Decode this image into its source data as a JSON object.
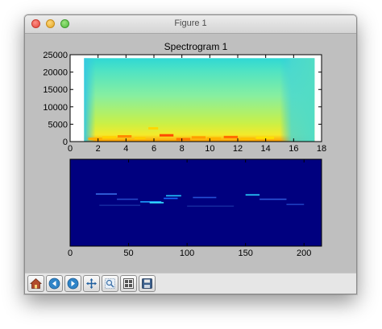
{
  "window": {
    "title": "Figure 1"
  },
  "figure": {
    "chart_data": [
      {
        "type": "heatmap",
        "title": "Spectrogram 1",
        "xlim": [
          0,
          18
        ],
        "ylim": [
          0,
          25000
        ],
        "x_ticks": [
          0,
          2,
          4,
          6,
          8,
          10,
          12,
          14,
          16,
          18
        ],
        "y_ticks": [
          0,
          5000,
          10000,
          15000,
          20000,
          25000
        ],
        "data_x_range": [
          1,
          17.5
        ],
        "data_y_range": [
          0,
          24000
        ],
        "colormap": "jet",
        "background": "#00007f",
        "grid": false,
        "low_band_bursts": [
          {
            "x0": 1.3,
            "x1": 2.3,
            "y": 800,
            "color": "#ffae00"
          },
          {
            "x0": 2.3,
            "x1": 3.3,
            "y": 1200,
            "color": "#ffd200"
          },
          {
            "x0": 3.4,
            "x1": 4.4,
            "y": 1500,
            "color": "#ff8a00"
          },
          {
            "x0": 4.6,
            "x1": 5.4,
            "y": 1000,
            "color": "#ffcc00"
          },
          {
            "x0": 5.6,
            "x1": 6.3,
            "y": 3800,
            "color": "#ffd600"
          },
          {
            "x0": 6.4,
            "x1": 7.4,
            "y": 1800,
            "color": "#ff4a00"
          },
          {
            "x0": 7.6,
            "x1": 8.6,
            "y": 700,
            "color": "#ff7a00"
          },
          {
            "x0": 8.7,
            "x1": 9.7,
            "y": 1200,
            "color": "#ff9c00"
          },
          {
            "x0": 9.8,
            "x1": 10.8,
            "y": 900,
            "color": "#ffb400"
          },
          {
            "x0": 11.0,
            "x1": 12.0,
            "y": 1300,
            "color": "#ff6c00"
          },
          {
            "x0": 12.2,
            "x1": 13.2,
            "y": 800,
            "color": "#ffc000"
          },
          {
            "x0": 13.3,
            "x1": 14.6,
            "y": 1100,
            "color": "#ffe000"
          }
        ]
      },
      {
        "type": "heatmap",
        "title": "",
        "xlim": [
          0,
          215
        ],
        "x_ticks": [
          0,
          50,
          100,
          150,
          200
        ],
        "show_y_ticks": false,
        "colormap": "jet",
        "background": "#00007f",
        "grid": false,
        "streaks": [
          {
            "x0": 22,
            "x1": 40,
            "y": 0.4,
            "color": "#3a6fe8"
          },
          {
            "x0": 40,
            "x1": 58,
            "y": 0.46,
            "color": "#2448c9"
          },
          {
            "x0": 60,
            "x1": 78,
            "y": 0.49,
            "color": "#1ea0ff"
          },
          {
            "x0": 68,
            "x1": 80,
            "y": 0.5,
            "color": "#36e7ff"
          },
          {
            "x0": 80,
            "x1": 92,
            "y": 0.45,
            "color": "#1a66ff"
          },
          {
            "x0": 82,
            "x1": 95,
            "y": 0.42,
            "color": "#22c8ff"
          },
          {
            "x0": 105,
            "x1": 125,
            "y": 0.44,
            "color": "#2550d6"
          },
          {
            "x0": 150,
            "x1": 162,
            "y": 0.41,
            "color": "#2ad4ff"
          },
          {
            "x0": 162,
            "x1": 185,
            "y": 0.46,
            "color": "#2d56d8"
          },
          {
            "x0": 185,
            "x1": 200,
            "y": 0.52,
            "color": "#1d3fbf"
          },
          {
            "x0": 25,
            "x1": 60,
            "y": 0.53,
            "color": "#14289e"
          },
          {
            "x0": 100,
            "x1": 140,
            "y": 0.54,
            "color": "#14289e"
          }
        ]
      }
    ]
  },
  "toolbar": {
    "buttons": [
      {
        "id": "home",
        "icon": "home-icon"
      },
      {
        "id": "back",
        "icon": "back-arrow-icon"
      },
      {
        "id": "forward",
        "icon": "forward-arrow-icon"
      },
      {
        "id": "pan",
        "icon": "pan-move-icon"
      },
      {
        "id": "zoom",
        "icon": "zoom-rect-icon"
      },
      {
        "id": "subplots",
        "icon": "subplots-config-icon"
      },
      {
        "id": "save",
        "icon": "save-disk-icon"
      }
    ]
  }
}
